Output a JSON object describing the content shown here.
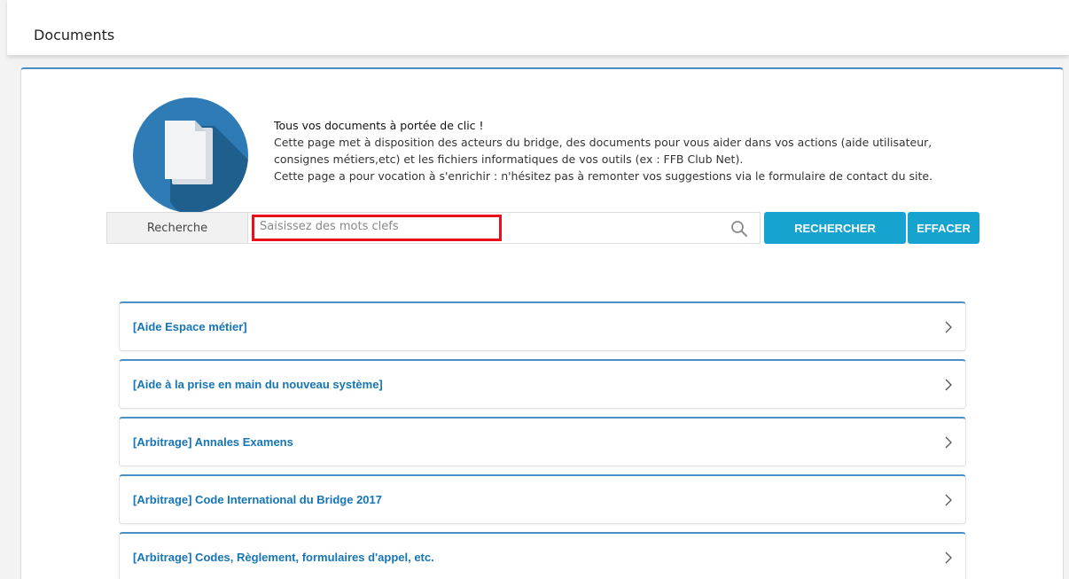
{
  "header": {
    "title": "Documents"
  },
  "intro": {
    "title": "Tous vos documents à portée de clic !",
    "line1": "Cette page met à disposition des acteurs du bridge, des documents pour vous aider dans vos actions (aide utilisateur,",
    "line2": "consignes métiers,etc) et les fichiers informatiques de vos outils (ex : FFB Club Net).",
    "line3": "Cette page a pour vocation à s'enrichir : n'hésitez pas à remonter vos suggestions via le formulaire de contact du site."
  },
  "search": {
    "label": "Recherche",
    "placeholder": "Saisissez des mots clefs",
    "value": "",
    "search_button": "RECHERCHER",
    "clear_button": "EFFACER"
  },
  "categories": [
    {
      "label": "[Aide Espace métier]"
    },
    {
      "label": "[Aide à la prise en main du nouveau système]"
    },
    {
      "label": "[Arbitrage] Annales Examens"
    },
    {
      "label": "[Arbitrage] Code International du Bridge 2017"
    },
    {
      "label": "[Arbitrage] Codes, Règlement, formulaires d'appel, etc."
    }
  ],
  "colors": {
    "accent": "#17a3cf",
    "link": "#1675b4",
    "panel_border": "#4a8fc4",
    "highlight": "#e8101a",
    "icon_circle": "#2e7bb6"
  },
  "icons": {
    "documents": "documents-icon",
    "search": "search-icon",
    "chevron": "chevron-right-icon"
  }
}
